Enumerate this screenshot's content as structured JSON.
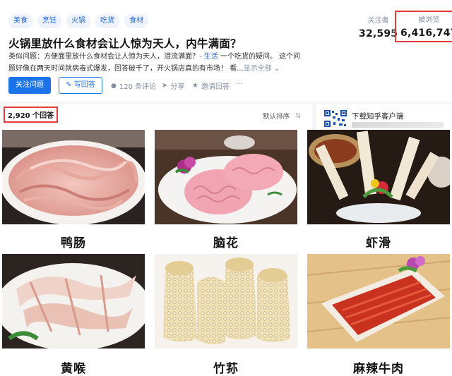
{
  "tags": [
    "美食",
    "烹饪",
    "火锅",
    "吃货",
    "食材"
  ],
  "stats": {
    "followers_label": "关注者",
    "followers_value": "32,595",
    "views_label": "被浏览",
    "views_value": "6,416,747"
  },
  "question": {
    "title": "火锅里放什么食材会让人惊为天人，内牛满面？",
    "excerpt_prefix": "类似问题：方便面里放什么食材会让人惊为天人，泪流满面？",
    "excerpt_link": "- 生活",
    "excerpt_body": " 一个吃货的疑问。 这个问题好像在两天时间就病毒式爆发，回答破千了，开火锅店真的有市场！ 看...",
    "show_all": "显示全部"
  },
  "actions": {
    "follow": "关注问题",
    "write": "写回答",
    "comments": "120 条评论",
    "share": "分享",
    "invite": "邀请回答",
    "more": "···"
  },
  "answers": {
    "count": "2,920 个回答",
    "sort": "默认排序"
  },
  "app_promo": {
    "title": "下载知乎客户端"
  },
  "foods": [
    {
      "name": "鸭肠"
    },
    {
      "name": "脑花"
    },
    {
      "name": "虾滑"
    },
    {
      "name": "黄喉"
    },
    {
      "name": "竹荪"
    },
    {
      "name": "麻辣牛肉"
    }
  ],
  "colors": {
    "accent": "#1a73e8",
    "highlight_border": "#e23b3b",
    "tag_bg": "#eef3fd"
  }
}
